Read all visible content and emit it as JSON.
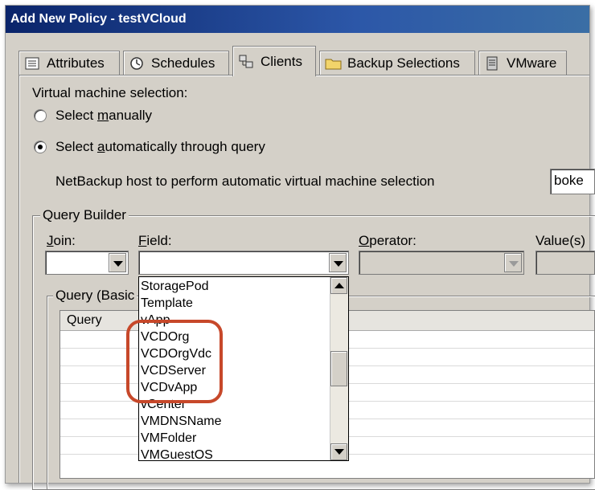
{
  "window": {
    "title": "Add New Policy - testVCloud"
  },
  "tabs": [
    {
      "label": "Attributes",
      "icon": "attributes-icon",
      "active": false
    },
    {
      "label": "Schedules",
      "icon": "schedules-icon",
      "active": false
    },
    {
      "label": "Clients",
      "icon": "clients-icon",
      "active": true
    },
    {
      "label": "Backup Selections",
      "icon": "folder-icon",
      "active": false
    },
    {
      "label": "VMware",
      "icon": "vmware-icon",
      "active": false
    }
  ],
  "vm_selection": {
    "heading": "Virtual machine selection:",
    "manual_prefix": "Select ",
    "manual_u": "m",
    "manual_suffix": "anually",
    "auto_prefix": "Select ",
    "auto_u": "a",
    "auto_suffix": "utomatically through query",
    "selected": "auto",
    "host_label": "NetBackup host to perform automatic virtual machine selection",
    "host_value": "boke"
  },
  "query_builder": {
    "title": "Query Builder",
    "join_u": "J",
    "join_rest": "oin:",
    "field_u": "F",
    "field_rest": "ield:",
    "operator_u": "O",
    "operator_rest": "perator:",
    "value_label": "Value(s)",
    "field_value": "",
    "join_value": ""
  },
  "query_basic": {
    "title": "Query (Basic",
    "column_header": "Query"
  },
  "field_dropdown": {
    "items": [
      "StoragePod",
      "Template",
      "vApp",
      "VCDOrg",
      "VCDOrgVdc",
      "VCDServer",
      "VCDvApp",
      "vCenter",
      "VMDNSName",
      "VMFolder",
      "VMGuestOS"
    ]
  },
  "colors": {
    "highlight": "#c7482a",
    "titlebar": "#0a246a"
  }
}
